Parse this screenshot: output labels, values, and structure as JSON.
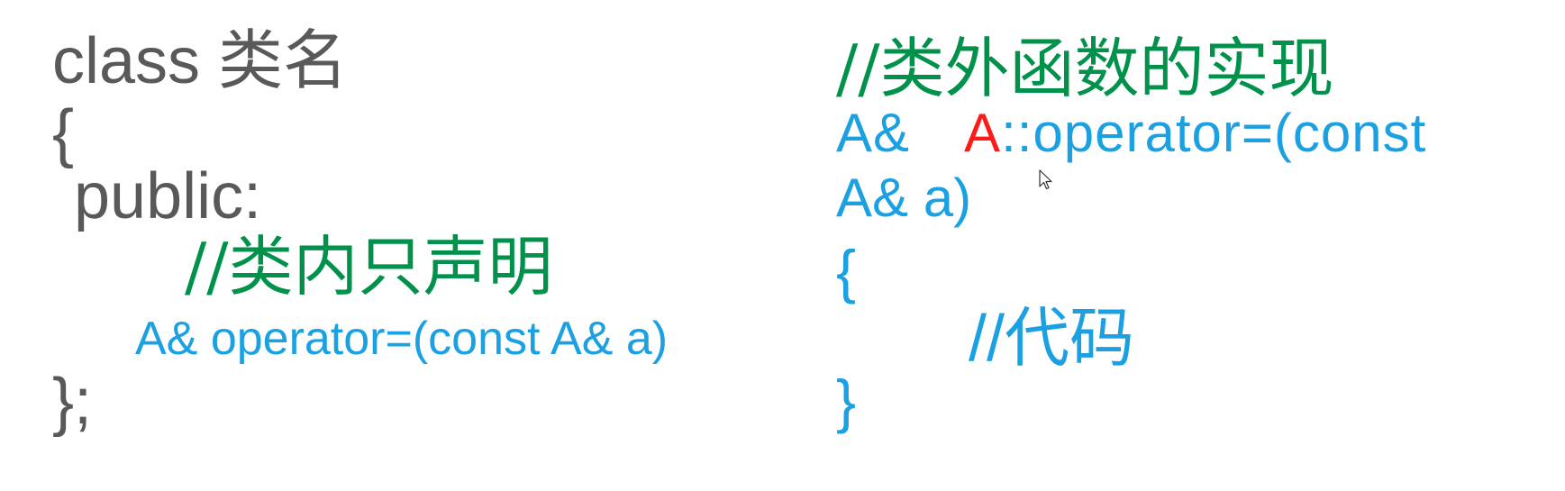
{
  "left": {
    "line1": "class 类名",
    "line2": "{",
    "line3": "public:",
    "line4": "//类内只声明",
    "line5": "A& operator=(const A& a)",
    "line6": "};"
  },
  "right": {
    "comment1": "//类外函数的实现",
    "line2_prefix": "A&",
    "line2_class": "A",
    "line2_rest": "::operator=(const",
    "line3": "A& a)",
    "line4": "{",
    "comment2": "//代码",
    "line6": "}"
  },
  "colors": {
    "text_gray": "#595959",
    "comment_green": "#00914b",
    "code_blue": "#1ba1e2",
    "class_red": "#ff1a1a",
    "background": "#ffffff"
  },
  "icons": {
    "cursor": "mouse-pointer-icon"
  }
}
